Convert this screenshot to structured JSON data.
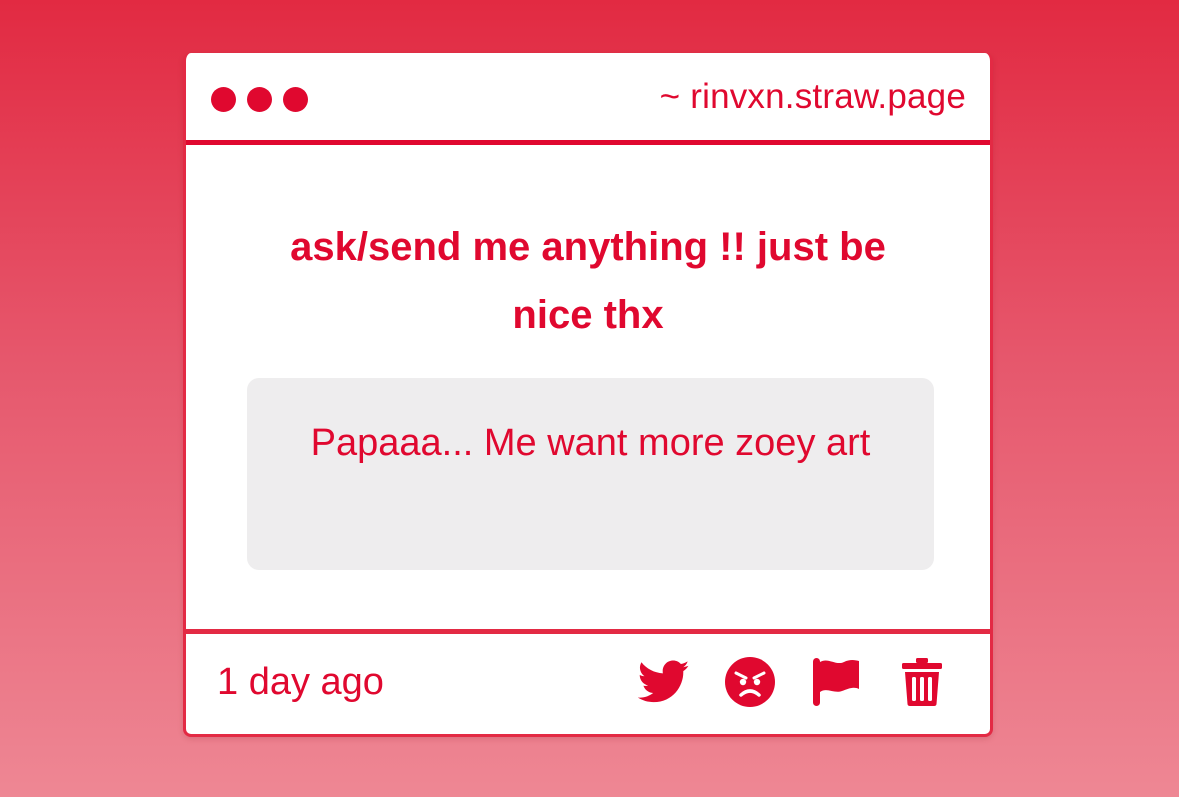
{
  "header": {
    "url": "~ rinvxn.straw.page"
  },
  "question": {
    "text": "ask/send me anything !! just be nice thx"
  },
  "answer": {
    "text": "Papaaa... Me want more zoey art"
  },
  "footer": {
    "timestamp": "1 day ago",
    "actions": [
      "twitter-icon",
      "angry-face-icon",
      "flag-icon",
      "trash-icon"
    ]
  },
  "colors": {
    "accent": "#e0082f",
    "card": "#ffffff",
    "answer_bg": "#eeedee"
  }
}
